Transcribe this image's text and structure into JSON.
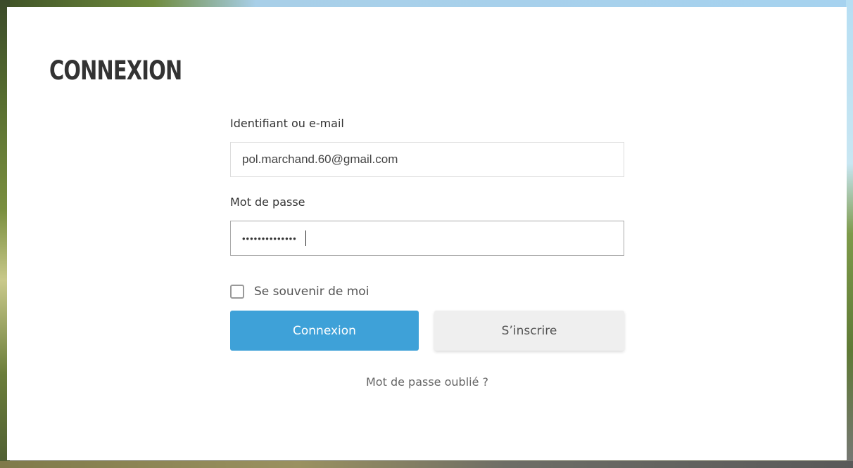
{
  "login": {
    "title": "CONNEXION",
    "username": {
      "label": "Identifiant ou e-mail",
      "value": "pol.marchand.60@gmail.com"
    },
    "password": {
      "label": "Mot de passe",
      "masked_value": "••••••••••••••"
    },
    "remember_me": {
      "label": "Se souvenir de moi",
      "checked": false
    },
    "buttons": {
      "login_label": "Connexion",
      "register_label": "S’inscrire"
    },
    "forgot_password_label": "Mot de passe oublié ?"
  },
  "colors": {
    "primary_button": "#3ea1d8",
    "secondary_button": "#efefef",
    "title": "#333333"
  }
}
